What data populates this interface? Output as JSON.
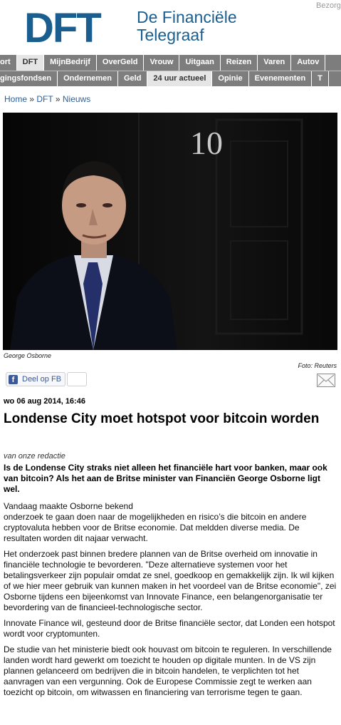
{
  "header": {
    "logo_mark": "DFT",
    "logo_line1": "De Financiële",
    "logo_line2": "Telegraaf",
    "top_link": "Bezorg"
  },
  "nav_primary": [
    "ort",
    "DFT",
    "MijnBedrijf",
    "OverGeld",
    "Vrouw",
    "Uitgaan",
    "Reizen",
    "Varen",
    "Autov"
  ],
  "nav_secondary": [
    "gingsfondsen",
    "Ondernemen",
    "Geld",
    "24 uur actueel",
    "Opinie",
    "Evenementen",
    "T"
  ],
  "breadcrumb": {
    "home": "Home",
    "sep": "»",
    "dft": "DFT",
    "news": "Nieuws"
  },
  "photo": {
    "door_number": "10",
    "caption": "George Osborne",
    "credit": "Foto: Reuters"
  },
  "share": {
    "fb_label": "Deel op FB"
  },
  "article": {
    "date": "wo 06 aug 2014, 16:46",
    "title": "Londense City moet hotspot voor bitcoin worden",
    "byline": "van onze redactie",
    "lead": "Is de Londense City straks niet alleen het financiële hart voor banken, maar ook van bitcoin? Als het aan de Britse minister van Financiën George Osborne ligt wel.",
    "p1_line1": "Vandaag maakte Osborne bekend",
    "p1_rest": "onderzoek te gaan doen naar de mogelijkheden en risico’s die bitcoin en andere cryptovaluta hebben voor de Britse economie. Dat meldden diverse media. De resultaten worden dit najaar verwacht.",
    "p2": "Het onderzoek past binnen bredere plannen van de Britse overheid om innovatie in financiële technologie te bevorderen. \"Deze alternatieve systemen voor het betalingsverkeer zijn populair omdat ze snel, goedkoop en gemakkelijk zijn. Ik wil kijken of we hier meer gebruik van kunnen maken in het voordeel van de Britse economie\", zei Osborne tijdens een bijeenkomst van Innovate Finance, een belangenorganisatie ter bevordering van de financieel-technologische sector.",
    "p3": "Innovate Finance wil, gesteund door de Britse financiële sector, dat Londen een hotspot wordt voor cryptomunten.",
    "p4": "De studie van het ministerie biedt ook houvast om bitcoin te reguleren. In verschillende landen wordt hard gewerkt om toezicht te houden op digitale munten. In de VS zijn plannen gelanceerd om bedrijven die in bitcoin handelen, te verplichten tot het aanvragen van een vergunning. Ook de Europese Commissie zegt te werken aan toezicht op bitcoin, om witwassen en financiering van terrorisme tegen te gaan."
  }
}
